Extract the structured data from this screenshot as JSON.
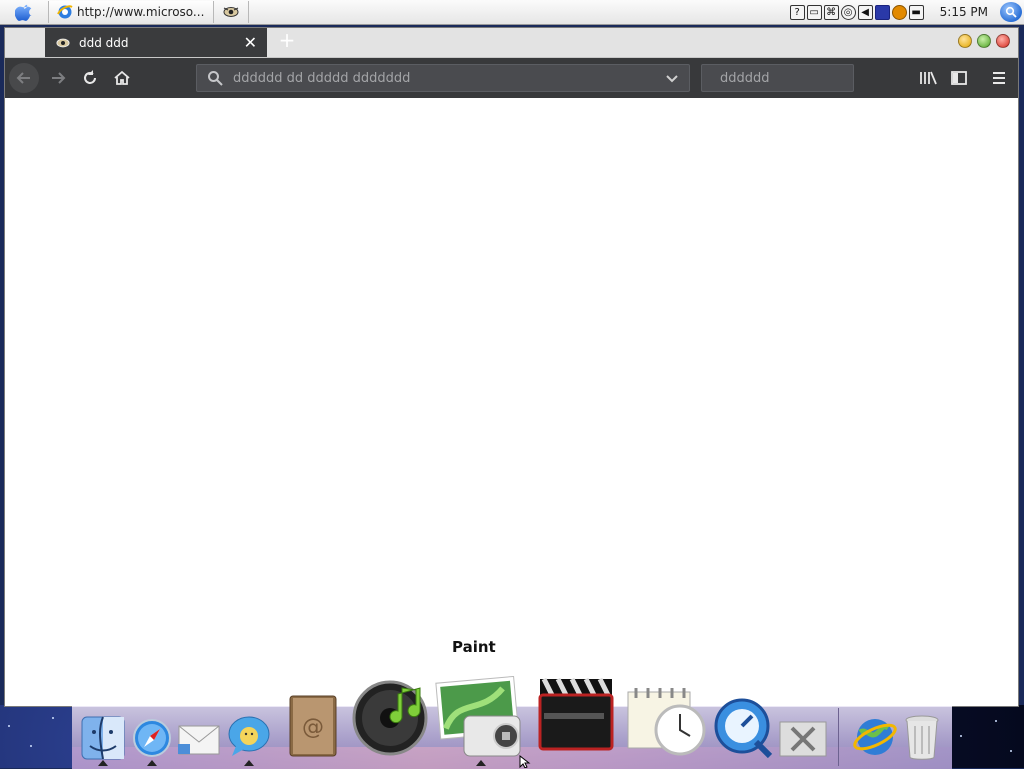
{
  "menubar": {
    "taskbar_items": [
      {
        "title": "http://www.microso...",
        "icon": "ie-icon"
      },
      {
        "title": "",
        "icon": "eye-app-icon"
      }
    ],
    "clock": "5:15 PM",
    "tray_icons": [
      "help-icon",
      "battery-icon",
      "network-icon",
      "cd-icon",
      "volume-icon",
      "keyboard-icon",
      "search-tray-icon",
      "display-icon"
    ]
  },
  "browser": {
    "tab_title": "ddd ddd",
    "url_placeholder": "dddddd dd ddddd ddddddd",
    "search_placeholder": "dddddd",
    "colors": {
      "toolbar": "#38393b",
      "tab": "#3a3b3d",
      "field": "#4a4b4f"
    }
  },
  "dock": {
    "hover_label": "Paint",
    "items": [
      "Finder",
      "Safari",
      "Mail",
      "iChat",
      "Address Book",
      "iTunes",
      "iPhoto",
      "Front Row",
      "iCal",
      "QuickTime",
      "Utilities",
      "Internet",
      "Trash"
    ]
  }
}
